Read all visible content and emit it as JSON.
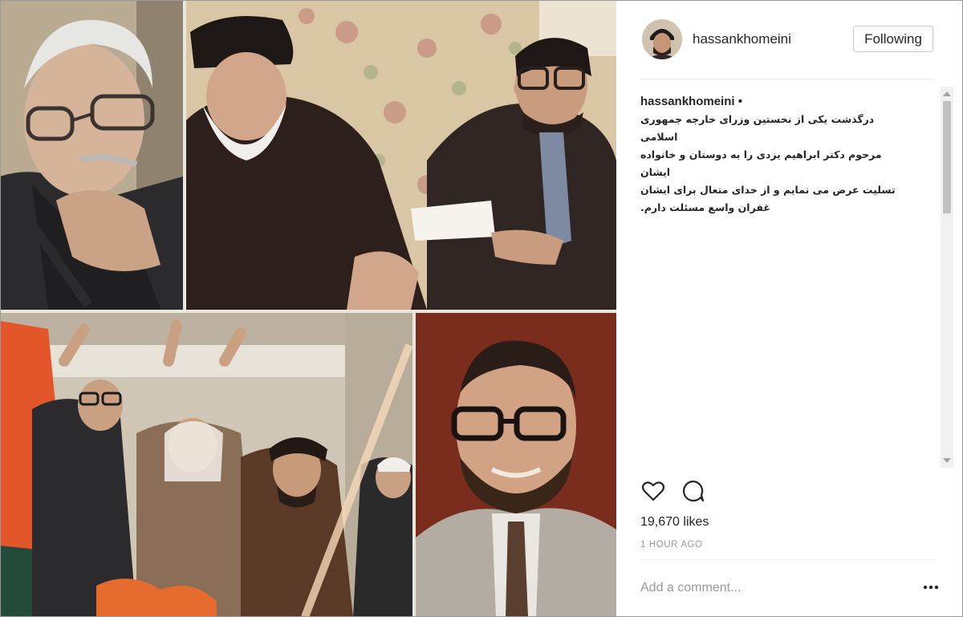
{
  "post": {
    "username": "hassankhomeini",
    "follow_label": "Following",
    "caption_user": "hassankhomeini",
    "caption_dot": " •",
    "caption_lines": [
      "درگذشت یکی از نخستین وزرای خارجه جمهوری اسلامی",
      "مرحوم دکتر ابراهیم یزدی را به دوستان و خانواده ایشان",
      "تسلیت عرض می نمایم و از خدای متعال برای ایشان",
      "غفران واسع مسئلت دارم."
    ],
    "likes": "19,670 likes",
    "time": "1 HOUR AGO",
    "comment_placeholder": "Add a comment..."
  },
  "icons": {
    "like": "heart-icon",
    "comment": "comment-icon",
    "more": "more-options-icon"
  },
  "colors": {
    "text": "#262626",
    "muted": "#999999",
    "border": "#efefef"
  }
}
